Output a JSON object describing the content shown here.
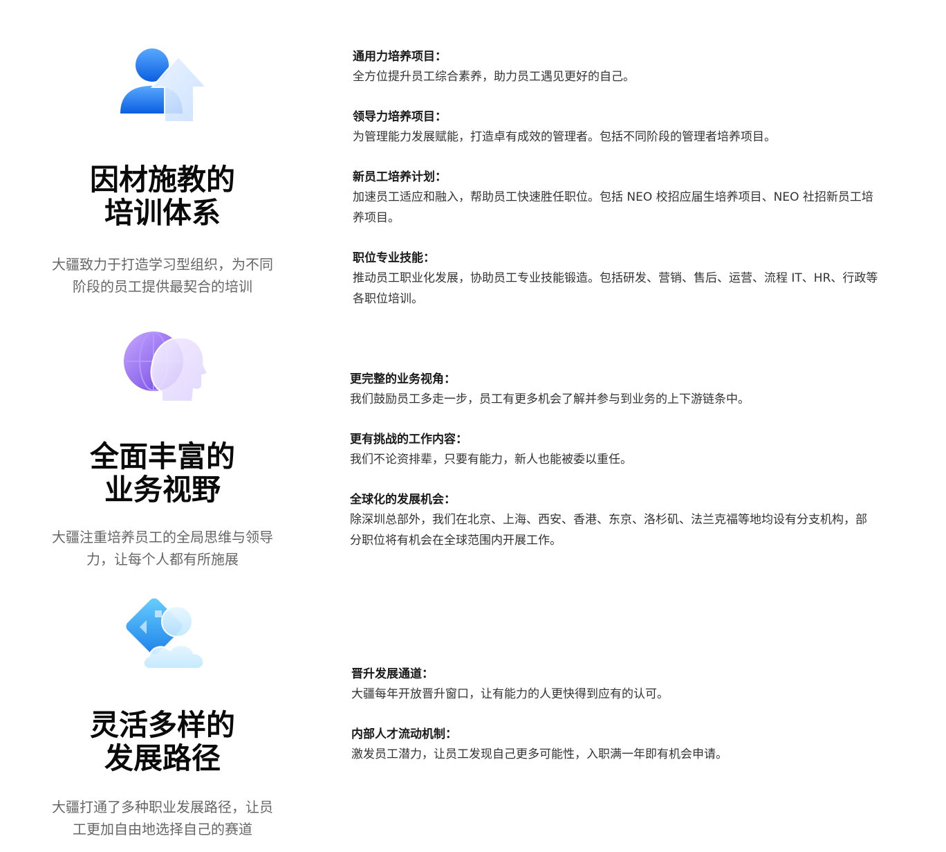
{
  "sections": [
    {
      "icon": "person-arrow-up-icon",
      "title_lines": [
        "因材施教的",
        "培训体系"
      ],
      "desc_lines": [
        "大疆致力于打造学习型组织，为不同",
        "阶段的员工提供最契合的培训"
      ],
      "items": [
        {
          "heading": "通用力培养项目：",
          "body_lines": [
            "全方位提升员工综合素养，助力员工遇见更好的自己。"
          ]
        },
        {
          "heading": "领导力培养项目：",
          "body_lines": [
            "为管理能力发展赋能，打造卓有成效的管理者。包括不同阶段的管理者培养项目。"
          ]
        },
        {
          "heading": "新员工培养计划：",
          "body_lines": [
            "加速员工适应和融入，帮助员工快速胜任职位。包括 NEO 校招应届生培养项目、NEO 社招新员工培",
            "养项目。"
          ]
        },
        {
          "heading": "职位专业技能：",
          "body_lines": [
            "推动员工职业化发展，协助员工专业技能锻造。包括研发、营销、售后、运营、流程 IT、HR、行政等",
            "各职位培训。"
          ]
        }
      ]
    },
    {
      "icon": "globe-head-icon",
      "title_lines": [
        "全面丰富的",
        "业务视野"
      ],
      "desc_lines": [
        "大疆注重培养员工的全局思维与领导",
        "力，让每个人都有所施展"
      ],
      "items": [
        {
          "heading": "更完整的业务视角：",
          "body_lines": [
            "我们鼓励员工多走一步，员工有更多机会了解并参与到业务的上下游链条中。"
          ]
        },
        {
          "heading": "更有挑战的工作内容：",
          "body_lines": [
            "我们不论资排辈，只要有能力，新人也能被委以重任。"
          ]
        },
        {
          "heading": "全球化的发展机会：",
          "body_lines": [
            "除深圳总部外，我们在北京、上海、西安、香港、东京、洛杉矶、法兰克福等地均设有分支机构，部",
            "分职位将有机会在全球范围内开展工作。"
          ]
        }
      ]
    },
    {
      "icon": "directions-cloud-icon",
      "title_lines": [
        "灵活多样的",
        "发展路径"
      ],
      "desc_lines": [
        "大疆打通了多种职业发展路径，让员",
        "工更加自由地选择自己的赛道"
      ],
      "items": [
        {
          "heading": "晋升发展通道：",
          "body_lines": [
            "大疆每年开放晋升窗口，让有能力的人更快得到应有的认可。"
          ]
        },
        {
          "heading": "内部人才流动机制：",
          "body_lines": [
            "激发员工潜力，让员工发现自己更多可能性，入职满一年即有机会申请。"
          ]
        }
      ]
    }
  ]
}
